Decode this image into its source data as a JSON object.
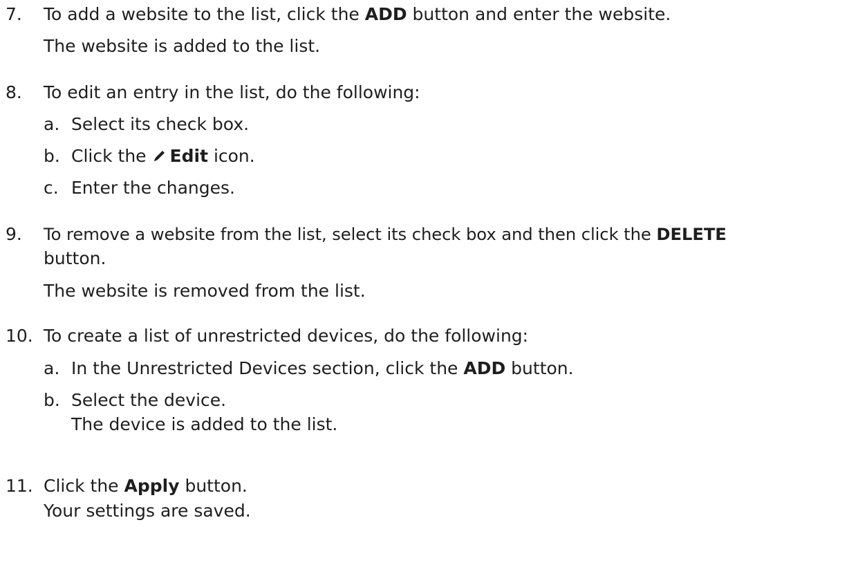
{
  "steps": [
    {
      "num": "7.",
      "pre": "To add a website to the list, click the ",
      "bold": "ADD",
      "post": " button and enter the website.",
      "result": "The website is added to the list."
    },
    {
      "num": "8.",
      "text": "To edit an entry in the list, do the following:",
      "substeps": [
        {
          "letter": "a.",
          "text": "Select its check box."
        },
        {
          "letter": "b.",
          "pre": "Click the ",
          "bold": "Edit",
          "post": " icon.",
          "icon": "pencil-icon"
        },
        {
          "letter": "c.",
          "text": "Enter the changes."
        }
      ]
    },
    {
      "num": "9.",
      "pre": "To remove a website from the list, select its check box and then click the ",
      "bold": "DELETE",
      "post_line2": "button.",
      "result": "The website is removed from the list."
    },
    {
      "num": "10.",
      "text": "To create a list of unrestricted devices, do the following:",
      "substeps": [
        {
          "letter": "a.",
          "pre": "In the Unrestricted Devices section, click the ",
          "bold": "ADD",
          "post": " button."
        },
        {
          "letter": "b.",
          "text": "Select the device.",
          "result": "The device is added to the list."
        }
      ]
    },
    {
      "num": "11.",
      "pre": "Click the ",
      "bold": "Apply",
      "post": " button.",
      "result": "Your settings are saved."
    }
  ]
}
